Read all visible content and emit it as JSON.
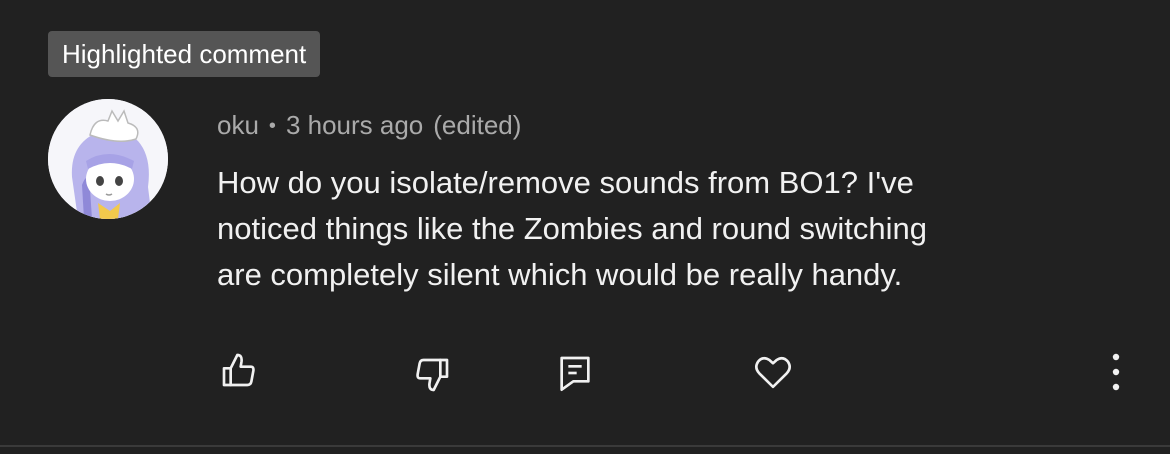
{
  "badge": {
    "label": "Highlighted comment"
  },
  "comment": {
    "author": "oku",
    "separator": "•",
    "time": "3 hours ago",
    "edited": "(edited)",
    "text": "How do you isolate/remove sounds from BO1? I've\nnoticed things like the Zombies and round switching\nare completely silent which would be really handy."
  },
  "actions": [
    {
      "icon": "thumbs-up-icon"
    },
    {
      "icon": "thumbs-down-icon"
    },
    {
      "icon": "reply-icon"
    },
    {
      "icon": "heart-icon"
    },
    {
      "icon": "more-vertical-icon"
    }
  ],
  "colors": {
    "background": "#212121",
    "badge_bg": "#555555",
    "text_primary": "#f1f1f1",
    "text_secondary": "#aaaaaa"
  }
}
